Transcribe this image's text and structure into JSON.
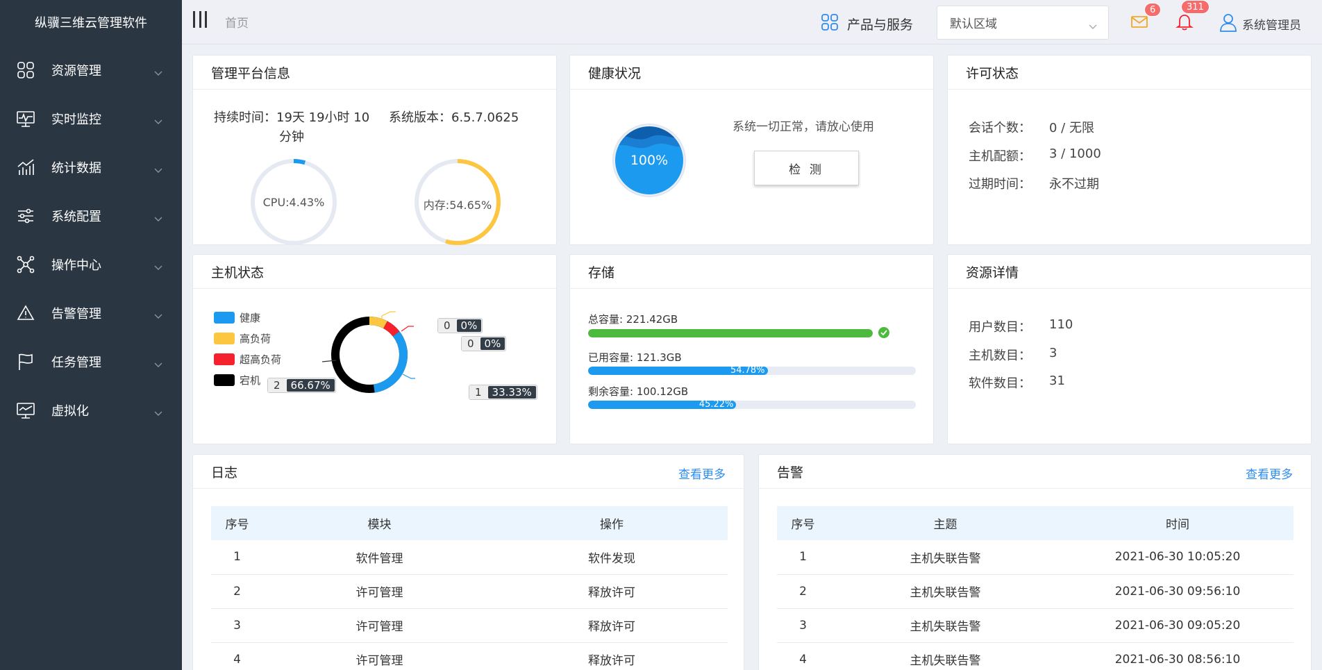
{
  "app": {
    "title": "纵骥三维云管理软件"
  },
  "sidebar": {
    "items": [
      {
        "label": "资源管理",
        "icon": "grid-icon"
      },
      {
        "label": "实时监控",
        "icon": "monitor-icon"
      },
      {
        "label": "统计数据",
        "icon": "chart-icon"
      },
      {
        "label": "系统配置",
        "icon": "sliders-icon"
      },
      {
        "label": "操作中心",
        "icon": "network-icon"
      },
      {
        "label": "告警管理",
        "icon": "warning-icon"
      },
      {
        "label": "任务管理",
        "icon": "flag-icon"
      },
      {
        "label": "虚拟化",
        "icon": "display-icon"
      }
    ]
  },
  "header": {
    "breadcrumb": "首页",
    "products": "产品与服务",
    "region": "默认区域",
    "mail_badge": "6",
    "bell_badge": "311",
    "user": "系统管理员"
  },
  "platform": {
    "title": "管理平台信息",
    "uptime_line1": "持续时间：19天 19小时 10",
    "uptime_line2": "分钟",
    "version": "系统版本：6.5.7.0625",
    "cpu_label": "CPU:4.43%",
    "cpu_value": 4.43,
    "mem_label": "内存:54.65%",
    "mem_value": 54.65
  },
  "health": {
    "title": "健康状况",
    "percent": "100%",
    "message": "系统一切正常，请放心使用",
    "button": "检 测"
  },
  "license": {
    "title": "许可状态",
    "rows": [
      {
        "key": "会话个数：",
        "value": "0 / 无限"
      },
      {
        "key": "主机配额：",
        "value": "3 / 1000"
      },
      {
        "key": "过期时间：",
        "value": "永不过期"
      }
    ]
  },
  "host": {
    "title": "主机状态",
    "legend": [
      {
        "name": "健康",
        "color": "#1b9af0"
      },
      {
        "name": "高负荷",
        "color": "#fcc641"
      },
      {
        "name": "超高负荷",
        "color": "#f5222d"
      },
      {
        "name": "宕机",
        "color": "#000000"
      }
    ],
    "chart_data": {
      "type": "pie",
      "categories": [
        "健康",
        "高负荷",
        "超高负荷",
        "宕机"
      ],
      "values": [
        1,
        0,
        0,
        2
      ],
      "labels": [
        {
          "count": "1",
          "percent": "33.33%"
        },
        {
          "count": "0",
          "percent": "0%"
        },
        {
          "count": "0",
          "percent": "0%"
        },
        {
          "count": "2",
          "percent": "66.67%"
        }
      ]
    }
  },
  "storage": {
    "title": "存储",
    "total_label": "总容量:  221.42GB",
    "used_label": "已用容量:  121.3GB",
    "used_pct": "54.78%",
    "used_value": 54.78,
    "free_label": "剩余容量:  100.12GB",
    "free_pct": "45.22%",
    "free_value": 45.22,
    "colors": {
      "total": "#4cba3d",
      "bar": "#1b9af0",
      "track": "#e8ebf3"
    }
  },
  "resources": {
    "title": "资源详情",
    "rows": [
      {
        "key": "用户数目：",
        "value": "110"
      },
      {
        "key": "主机数目：",
        "value": "3"
      },
      {
        "key": "软件数目：",
        "value": "31"
      }
    ]
  },
  "logs": {
    "title": "日志",
    "more": "查看更多",
    "columns": [
      "序号",
      "模块",
      "操作"
    ],
    "rows": [
      [
        "1",
        "软件管理",
        "软件发现"
      ],
      [
        "2",
        "许可管理",
        "释放许可"
      ],
      [
        "3",
        "许可管理",
        "释放许可"
      ],
      [
        "4",
        "许可管理",
        "释放许可"
      ]
    ]
  },
  "alarms": {
    "title": "告警",
    "more": "查看更多",
    "columns": [
      "序号",
      "主题",
      "时间"
    ],
    "rows": [
      [
        "1",
        "主机失联告警",
        "2021-06-30 10:05:20"
      ],
      [
        "2",
        "主机失联告警",
        "2021-06-30 09:56:10"
      ],
      [
        "3",
        "主机失联告警",
        "2021-06-30 09:05:20"
      ],
      [
        "4",
        "主机失联告警",
        "2021-06-30 08:56:10"
      ]
    ]
  }
}
